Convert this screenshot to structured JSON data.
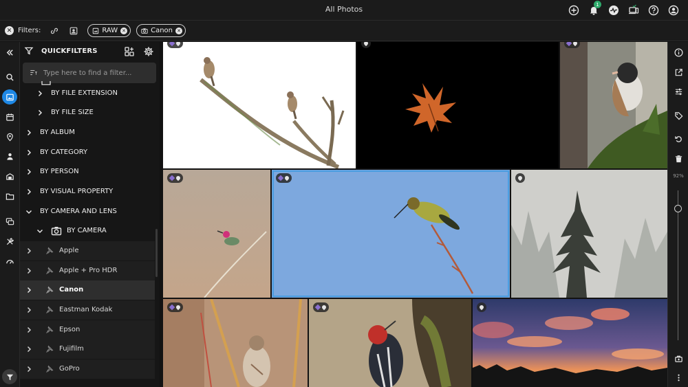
{
  "window": {
    "title": "All Photos"
  },
  "topbar": {
    "notification_count": "1"
  },
  "filterbar": {
    "label": "Filters:",
    "chips": [
      {
        "label": "RAW"
      },
      {
        "label": "Canon"
      }
    ]
  },
  "panel": {
    "title": "QUICKFILTERS",
    "search_placeholder": "Type here to find a filter...",
    "tree": {
      "by_file_extension": "BY FILE EXTENSION",
      "by_file_size": "BY FILE SIZE",
      "by_album": "BY ALBUM",
      "by_category": "BY CATEGORY",
      "by_person": "BY PERSON",
      "by_visual_property": "BY VISUAL PROPERTY",
      "by_camera_and_lens": "BY CAMERA AND LENS",
      "by_camera": "BY CAMERA",
      "cameras": [
        "Apple",
        "Apple + Pro HDR",
        "Canon",
        "Eastman Kodak",
        "Epson",
        "Fujifilm",
        "GoPro"
      ],
      "selected_camera": "Canon"
    }
  },
  "rightrail": {
    "zoom": "92%",
    "zoom_level": 0.92
  },
  "colors": {
    "accent": "#1e88e5",
    "selection": "#4a9de0",
    "badge": "#2faa6b"
  }
}
